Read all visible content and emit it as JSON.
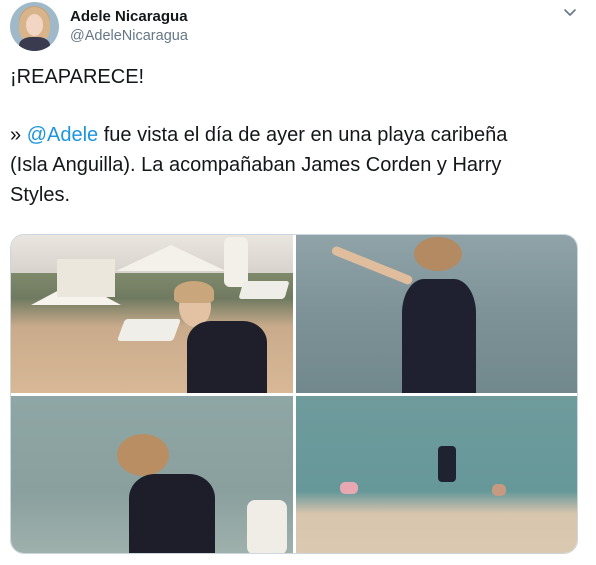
{
  "author": {
    "name": "Adele Nicaragua",
    "handle": "@AdeleNicaragua"
  },
  "tweet": {
    "headline": "¡REAPARECE!",
    "line1_prefix": "» ",
    "line1_mention": "@Adele",
    "line1_rest": " fue vista el día de ayer en una playa caribeña",
    "line2": "(Isla Anguilla). La acompañaban James Corden y Harry",
    "line3": "Styles."
  },
  "icons": {
    "menu": "chevron-down-icon"
  },
  "colors": {
    "text": "#14171a",
    "secondary": "#657786",
    "mention": "#1b95e0",
    "border": "#ccd6dd"
  }
}
